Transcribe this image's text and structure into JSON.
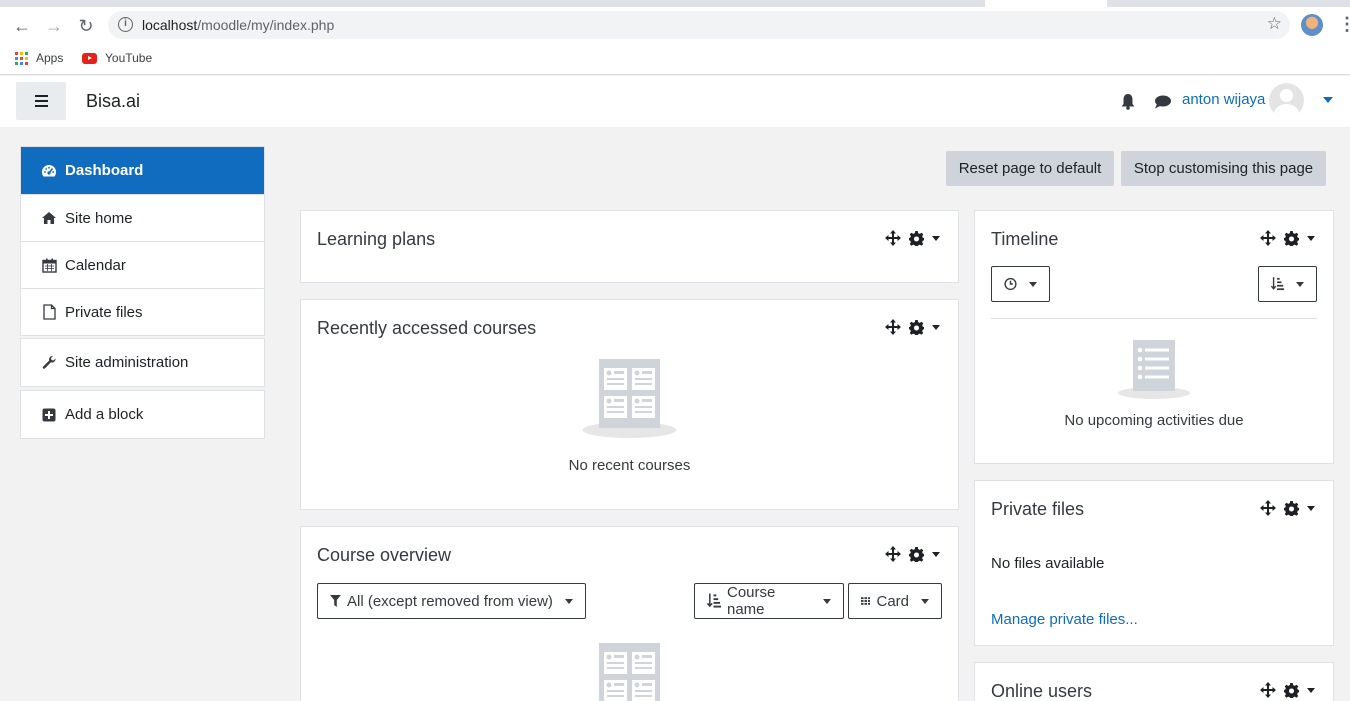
{
  "browser": {
    "url_host": "localhost",
    "url_path": "/moodle/my/index.php",
    "bookmarks": [
      {
        "label": "Apps",
        "icon": "apps-grid-icon"
      },
      {
        "label": "YouTube",
        "icon": "youtube-icon"
      }
    ]
  },
  "navbar": {
    "brand": "Bisa.ai",
    "username": "anton wijaya"
  },
  "drawer": {
    "items": [
      {
        "label": "Dashboard",
        "icon": "dashboard-icon",
        "active": true
      },
      {
        "label": "Site home",
        "icon": "home-icon"
      },
      {
        "label": "Calendar",
        "icon": "calendar-icon"
      },
      {
        "label": "Private files",
        "icon": "file-icon"
      },
      {
        "label": "Site administration",
        "icon": "wrench-icon"
      },
      {
        "label": "Add a block",
        "icon": "plus-square-icon"
      }
    ]
  },
  "page_actions": {
    "reset": "Reset page to default",
    "stop": "Stop customising this page"
  },
  "blocks": {
    "learning_plans": {
      "title": "Learning plans"
    },
    "recent_courses": {
      "title": "Recently accessed courses",
      "empty": "No recent courses"
    },
    "course_overview": {
      "title": "Course overview",
      "filter": "All (except removed from view)",
      "sort": "Course name",
      "view": "Card"
    },
    "timeline": {
      "title": "Timeline",
      "empty": "No upcoming activities due"
    },
    "private_files": {
      "title": "Private files",
      "empty": "No files available",
      "manage": "Manage private files..."
    },
    "online_users": {
      "title": "Online users"
    }
  },
  "colors": {
    "primary": "#0f6cbf",
    "page_bg": "#f2f2f2",
    "secondary_btn": "#ced4da"
  }
}
